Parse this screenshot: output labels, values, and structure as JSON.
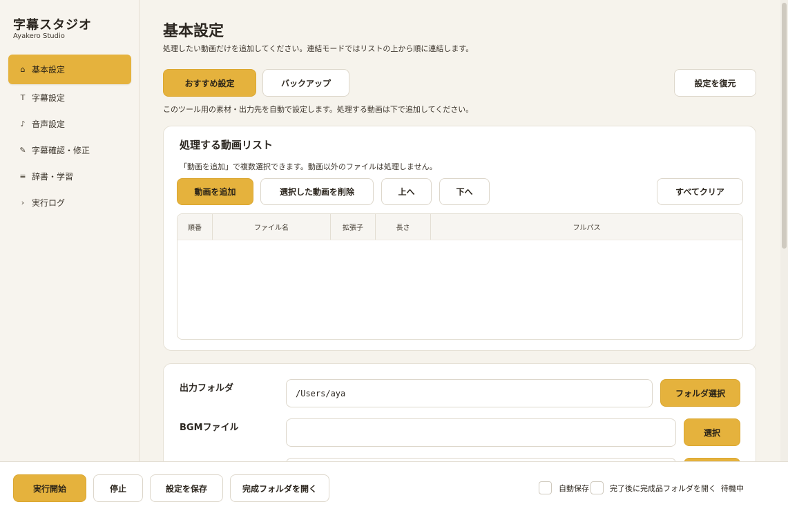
{
  "app": {
    "title": "字幕スタジオ",
    "subtitle": "Ayakero Studio"
  },
  "sidebar": {
    "items": [
      {
        "icon": "home-icon",
        "glyph": "⌂",
        "label": "基本設定"
      },
      {
        "icon": "text-icon",
        "glyph": "T",
        "label": "字幕設定"
      },
      {
        "icon": "music-note-icon",
        "glyph": "♪",
        "label": "音声設定"
      },
      {
        "icon": "pencil-icon",
        "glyph": "✎",
        "label": "字幕確認・修正"
      },
      {
        "icon": "list-icon",
        "glyph": "≡",
        "label": "辞書・学習"
      },
      {
        "icon": "chevron-right-icon",
        "glyph": "›",
        "label": "実行ログ"
      }
    ]
  },
  "main": {
    "title": "基本設定",
    "description": "処理したい動画だけを追加してください。連結モードではリストの上から順に連結します。",
    "toolbar": {
      "recommended": "おすすめ設定",
      "backup": "バックアップ",
      "restore": "設定を復元"
    },
    "hint": "このツール用の素材・出力先を自動で設定します。処理する動画は下で追加してください。",
    "video_list": {
      "title": "処理する動画リスト",
      "note": "「動画を追加」で複数選択できます。動画以外のファイルは処理しません。",
      "buttons": {
        "add": "動画を追加",
        "remove": "選択した動画を削除",
        "up": "上へ",
        "down": "下へ",
        "clear": "すべてクリア"
      },
      "columns": [
        "順番",
        "ファイル名",
        "拡張子",
        "長さ",
        "フルパス"
      ],
      "rows": []
    },
    "paths": {
      "output_label": "出力フォルダ",
      "output_value": "/Users/aya",
      "output_button": "フォルダ選択",
      "bgm_label": "BGMファイル",
      "bgm_value": "",
      "bgm_button": "選択"
    }
  },
  "footer": {
    "run": "実行開始",
    "stop": "停止",
    "save": "設定を保存",
    "open_folder": "完成フォルダを開く",
    "autosave": "自動保存",
    "open_after": "完了後に完成品フォルダを開く",
    "status": "待機中"
  },
  "colors": {
    "accent": "#e5b23d",
    "background": "#f6f3ec",
    "card": "#ffffff"
  }
}
